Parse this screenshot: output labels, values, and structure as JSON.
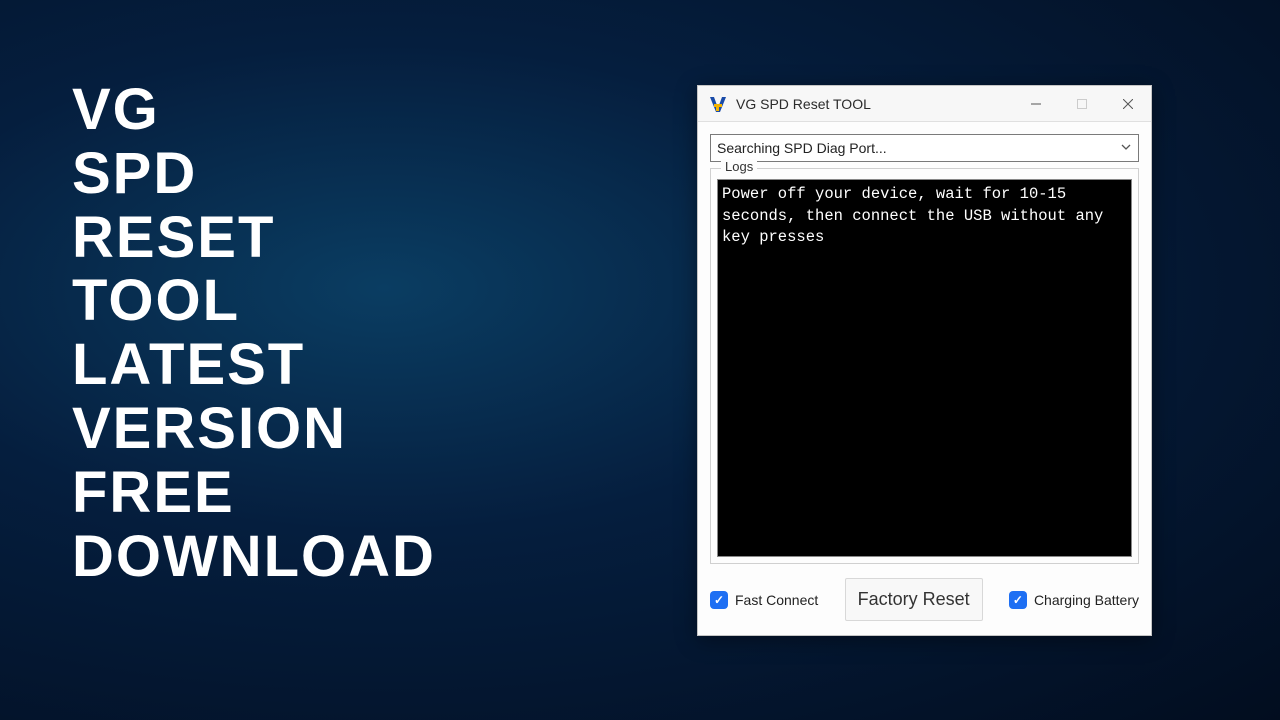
{
  "promo": {
    "line1": "VG",
    "line2": "SPD",
    "line3": "RESET",
    "line4": "TOOL",
    "line5": "LATEST",
    "line6": "VERSION",
    "line7": "FREE",
    "line8": "DOWNLOAD"
  },
  "window": {
    "title": "VG SPD Reset TOOL",
    "icon_name": "vg-app-icon"
  },
  "dropdown": {
    "selected": "Searching SPD Diag Port..."
  },
  "logs": {
    "legend": "Logs",
    "content": "Power off your device, wait for 10-15 seconds, then connect the USB without any key presses"
  },
  "controls": {
    "fast_connect_label": "Fast Connect",
    "fast_connect_checked": true,
    "factory_reset_label": "Factory Reset",
    "charging_battery_label": "Charging Battery",
    "charging_battery_checked": true
  }
}
